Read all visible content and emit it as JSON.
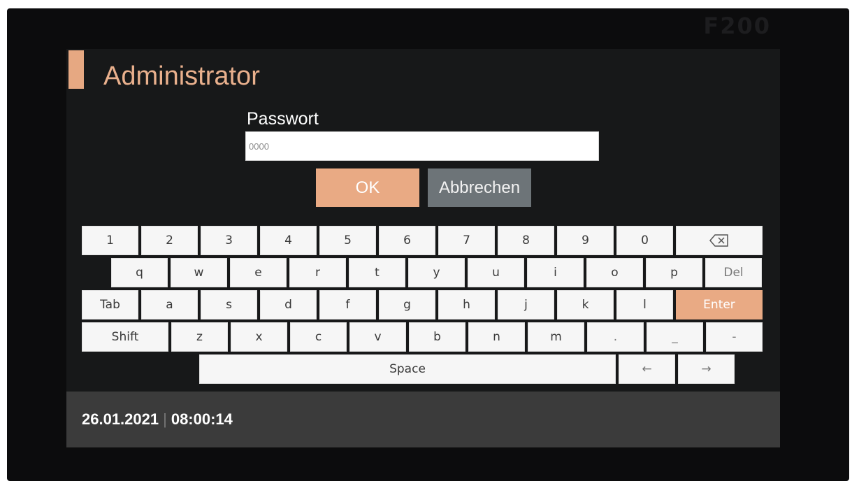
{
  "device": {
    "model": "F200"
  },
  "title": "Administrator",
  "password": {
    "label": "Passwort",
    "value": "0000"
  },
  "buttons": {
    "ok": "OK",
    "cancel": "Abbrechen"
  },
  "keyboard": {
    "row1": [
      "1",
      "2",
      "3",
      "4",
      "5",
      "6",
      "7",
      "8",
      "9",
      "0"
    ],
    "row2": [
      "q",
      "w",
      "e",
      "r",
      "t",
      "y",
      "u",
      "i",
      "o",
      "p"
    ],
    "row3": [
      "a",
      "s",
      "d",
      "f",
      "g",
      "h",
      "j",
      "k",
      "l"
    ],
    "row4": [
      "z",
      "x",
      "c",
      "v",
      "b",
      "n",
      "m",
      ".",
      "_",
      "-"
    ],
    "del": "Del",
    "tab": "Tab",
    "enter": "Enter",
    "shift": "Shift",
    "space": "Space",
    "left": "←",
    "right": "→",
    "backspace_icon": "backspace-icon"
  },
  "status": {
    "date": "26.01.2021",
    "time": "08:00:14"
  },
  "colors": {
    "accent": "#e9aa84",
    "cancel": "#6d7478",
    "screen": "#171819",
    "status_bar": "#3b3b3b"
  }
}
